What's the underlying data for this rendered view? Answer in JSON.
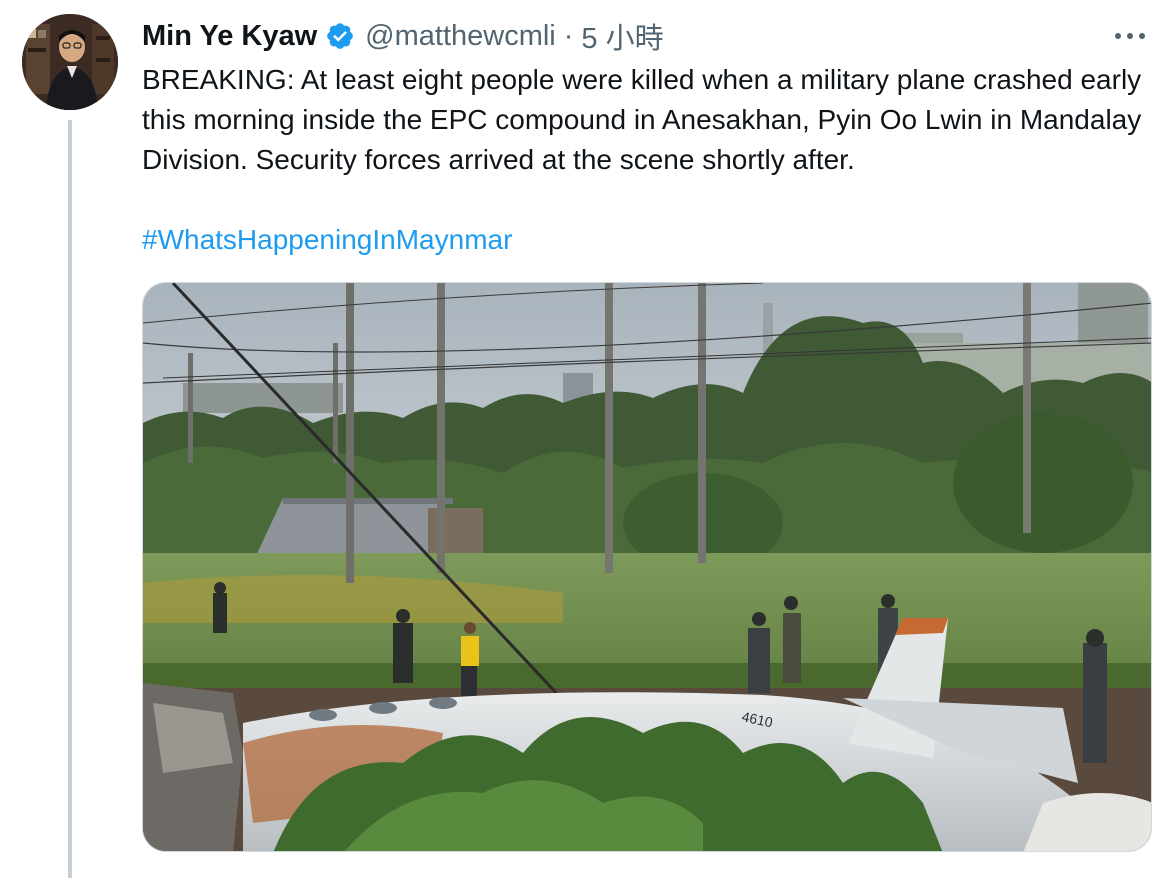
{
  "author": {
    "display_name": "Min Ye Kyaw",
    "handle": "@matthewcmli",
    "separator": "·",
    "timestamp": "5 小時",
    "verified": true,
    "verified_color": "#1d9bf0"
  },
  "tweet": {
    "text": "BREAKING: At least eight people were killed when a military plane crashed early this morning inside the EPC compound in Anesakhan, Pyin Oo Lwin in Mandalay Division. Security forces arrived at the scene shortly after.",
    "hashtag": "#WhatsHappeningInMaynmar",
    "link_color": "#1d9bf0"
  },
  "media": {
    "aircraft_tail_number": "4610"
  },
  "icons": {
    "more": "more-options-icon",
    "verified": "verified-badge-icon"
  }
}
